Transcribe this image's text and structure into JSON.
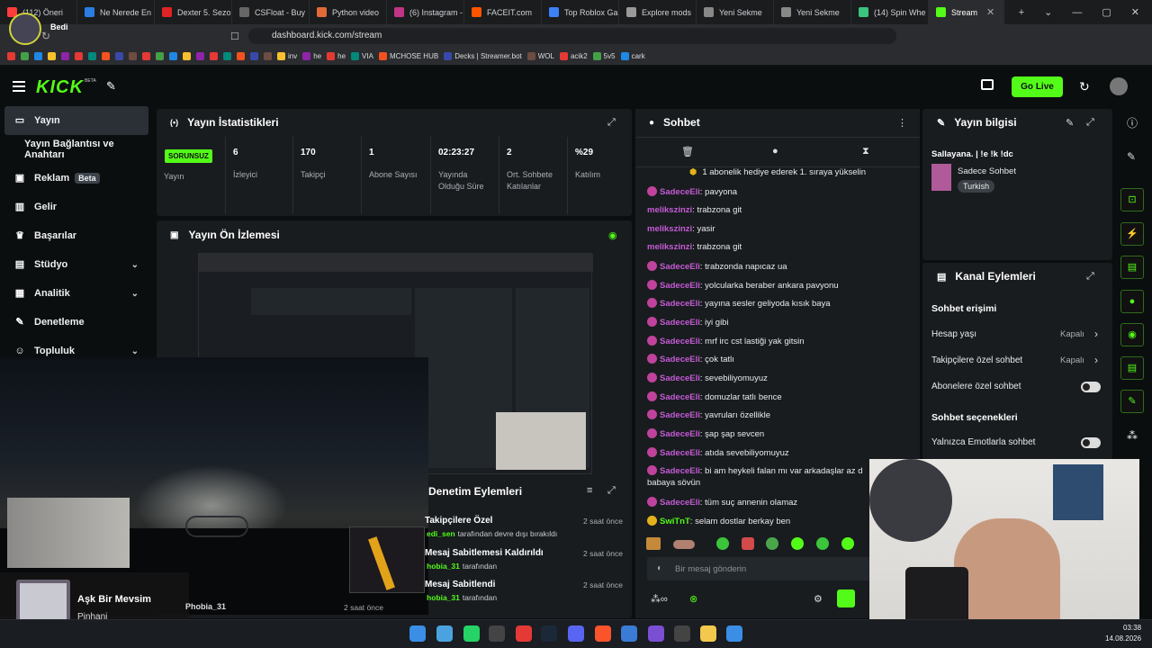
{
  "browser": {
    "tabs": [
      {
        "label": "(112) Öneri",
        "color": "#ff3b3b"
      },
      {
        "label": "Ne Nerede En",
        "color": "#2a7de1"
      },
      {
        "label": "Dexter 5. Sezo",
        "color": "#e02424"
      },
      {
        "label": "CSFloat - Buy",
        "color": "#666"
      },
      {
        "label": "Python video",
        "color": "#e06a3a"
      },
      {
        "label": "(6) Instagram -",
        "color": "#c13584"
      },
      {
        "label": "FACEIT.com",
        "color": "#ff5500"
      },
      {
        "label": "Top Roblox Ga",
        "color": "#3b82f6"
      },
      {
        "label": "Explore mods",
        "color": "#999"
      },
      {
        "label": "Yeni Sekme",
        "color": "#888"
      },
      {
        "label": "Yeni Sekme",
        "color": "#888"
      },
      {
        "label": "(14) Spin Whe",
        "color": "#3ac47d"
      },
      {
        "label": "Stream",
        "color": "#53fc18"
      }
    ],
    "url": "dashboard.kick.com/stream",
    "profile_name": "Bedi",
    "bookmarks": [
      "inv",
      "he",
      "he",
      "VIA",
      "MCHOSE HUB",
      "Decks | Streamer.bot",
      "WOL",
      "acik2",
      "5v5",
      "cark"
    ]
  },
  "topnav": {
    "logo": "KICK",
    "beta": "BETA",
    "go_live": "Go Live"
  },
  "sidebar": {
    "items": [
      {
        "label": "Yayın",
        "icon": "broadcast-icon"
      },
      {
        "label": "Yayın Bağlantısı ve Anahtarı",
        "icon": ""
      },
      {
        "label": "Reklam",
        "badge": "Beta",
        "icon": "ad-icon"
      },
      {
        "label": "Gelir",
        "icon": "chart-icon"
      },
      {
        "label": "Başarılar",
        "icon": "trophy-icon"
      },
      {
        "label": "Stüdyo",
        "icon": "studio-icon"
      },
      {
        "label": "Analitik",
        "icon": "analytics-icon"
      },
      {
        "label": "Denetleme",
        "icon": "wrench-icon"
      },
      {
        "label": "Topluluk",
        "icon": "community-icon"
      }
    ]
  },
  "stats": {
    "title": "Yayın İstatistikleri",
    "live_badge": "SORUNSUZ",
    "status_label": "Yayın",
    "items": [
      {
        "value": "6",
        "label": "İzleyici"
      },
      {
        "value": "170",
        "label": "Takipçi"
      },
      {
        "value": "1",
        "label": "Abone Sayısı"
      },
      {
        "value": "02:23:27",
        "label": "Yayında Olduğu Süre"
      },
      {
        "value": "2",
        "label": "Ort. Sohbete Katılanlar"
      },
      {
        "value": "%29",
        "label": "Katılım"
      }
    ]
  },
  "preview": {
    "title": "Yayın Ön İzlemesi",
    "music_title": "Aşk Bir Mevsim",
    "music_artist": "Pinhani",
    "overlay_user": "Phobia_31",
    "overlay_time": "2 saat önce"
  },
  "moderation": {
    "title": "Denetim Eylemleri",
    "items": [
      {
        "title": "Takipçilere Özel",
        "user": "edi_sen",
        "desc": "tarafından devre dışı bırakıldı",
        "time": "2 saat önce"
      },
      {
        "title": "Mesaj Sabitlemesi Kaldırıldı",
        "user": "hobia_31",
        "desc": "tarafından",
        "time": "2 saat önce"
      },
      {
        "title": "Mesaj Sabitlendi",
        "user": "hobia_31",
        "desc": "tarafından",
        "time": "2 saat önce"
      }
    ]
  },
  "chat": {
    "title": "Sohbet",
    "pinned": "1 abonelik hediye ederek 1. sıraya yükselin",
    "placeholder": "Bir mesaj gönderin",
    "messages": [
      {
        "user": "SadeceEli",
        "text": "pavyona",
        "badge": true,
        "color": "#c65bd6"
      },
      {
        "user": "melikszinzi",
        "text": "trabzona git",
        "badge": false,
        "color": "#c65bd6"
      },
      {
        "user": "melikszinzi",
        "text": "yasir",
        "badge": false,
        "color": "#c65bd6"
      },
      {
        "user": "melikszinzi",
        "text": "trabzona git",
        "badge": false,
        "color": "#c65bd6"
      },
      {
        "user": "SadeceEli",
        "text": "trabzonda napıcaz ua",
        "badge": true,
        "color": "#c65bd6"
      },
      {
        "user": "SadeceEli",
        "text": "yolcularka beraber ankara pavyonu",
        "badge": true,
        "color": "#c65bd6"
      },
      {
        "user": "SadeceEli",
        "text": "yayına sesler geliyoda kısık baya",
        "badge": true,
        "color": "#c65bd6"
      },
      {
        "user": "SadeceEli",
        "text": "iyi gibi",
        "badge": true,
        "color": "#c65bd6"
      },
      {
        "user": "SadeceEli",
        "text": "mrf irc cst lastiği yak gitsin",
        "badge": true,
        "color": "#c65bd6"
      },
      {
        "user": "SadeceEli",
        "text": "çok tatlı",
        "badge": true,
        "color": "#c65bd6"
      },
      {
        "user": "SadeceEli",
        "text": "sevebiliyomuyuz",
        "badge": true,
        "color": "#c65bd6"
      },
      {
        "user": "SadeceEli",
        "text": "domuzlar tatlı bence",
        "badge": true,
        "color": "#c65bd6"
      },
      {
        "user": "SadeceEli",
        "text": "yavruları özellikle",
        "badge": true,
        "color": "#c65bd6"
      },
      {
        "user": "SadeceEli",
        "text": "şap şap sevcen",
        "badge": true,
        "color": "#c65bd6"
      },
      {
        "user": "SadeceEli",
        "text": "atıda sevebiliyomuyuz",
        "badge": true,
        "color": "#c65bd6"
      },
      {
        "user": "SadeceEli",
        "text": "bi am heykeli falan mı var arkadaşlar az d",
        "badge": true,
        "color": "#c65bd6"
      },
      {
        "user": "",
        "text": "babaya sövün",
        "badge": false,
        "color": "#c65bd6"
      },
      {
        "user": "SadeceEli",
        "text": "tüm suç annenin olamaz",
        "badge": true,
        "color": "#c65bd6"
      },
      {
        "user": "SwiTnT",
        "text": "selam dostlar berkay ben",
        "badge": true,
        "color": "#53fc18"
      }
    ]
  },
  "stream_info": {
    "title": "Yayın bilgisi",
    "stream_title": "Sallayana. | !e !k !dc",
    "category": "Sadece Sohbet",
    "tag": "Turkish"
  },
  "channel_actions": {
    "title": "Kanal Eylemleri",
    "access_heading": "Sohbet erişimi",
    "rows": [
      {
        "label": "Hesap yaşı",
        "value": "Kapalı"
      },
      {
        "label": "Takipçilere özel sohbet",
        "value": "Kapalı"
      },
      {
        "label": "Abonelere özel sohbet",
        "value": ""
      }
    ],
    "options_heading": "Sohbet seçenekleri",
    "emote_only": "Yalnızca Emotlarla sohbet"
  },
  "taskbar": {
    "time": "03:38",
    "date": "14.08.2026"
  },
  "colors": {
    "accent": "#53fc18",
    "panel": "#181c1f",
    "bg": "#0b0e0f",
    "username": "#c65bd6"
  }
}
